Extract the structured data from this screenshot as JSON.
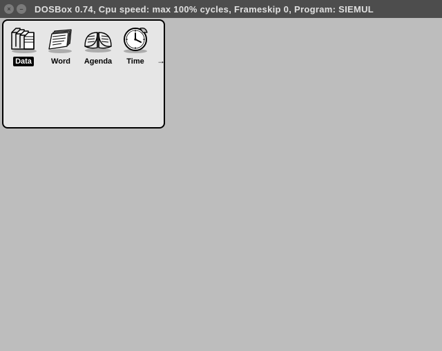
{
  "window": {
    "title": "DOSBox 0.74, Cpu speed: max 100% cycles, Frameskip  0, Program:   SIEMUL"
  },
  "launcher": {
    "items": [
      {
        "label": "Data",
        "selected": true
      },
      {
        "label": "Word",
        "selected": false
      },
      {
        "label": "Agenda",
        "selected": false
      },
      {
        "label": "Time",
        "selected": false
      }
    ],
    "scroll_arrow": "→"
  }
}
